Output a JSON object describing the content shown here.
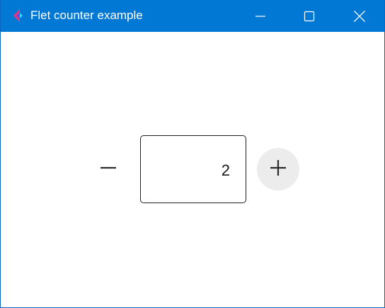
{
  "window": {
    "title": "Flet counter example",
    "titlebar_color": "#0078d4",
    "controls": {
      "minimize_icon": "minimize-icon",
      "maximize_icon": "maximize-icon",
      "close_icon": "close-icon"
    }
  },
  "counter": {
    "value": "2",
    "decrement_icon": "minus-icon",
    "increment_icon": "plus-icon",
    "increment_bg": "#ececed"
  }
}
